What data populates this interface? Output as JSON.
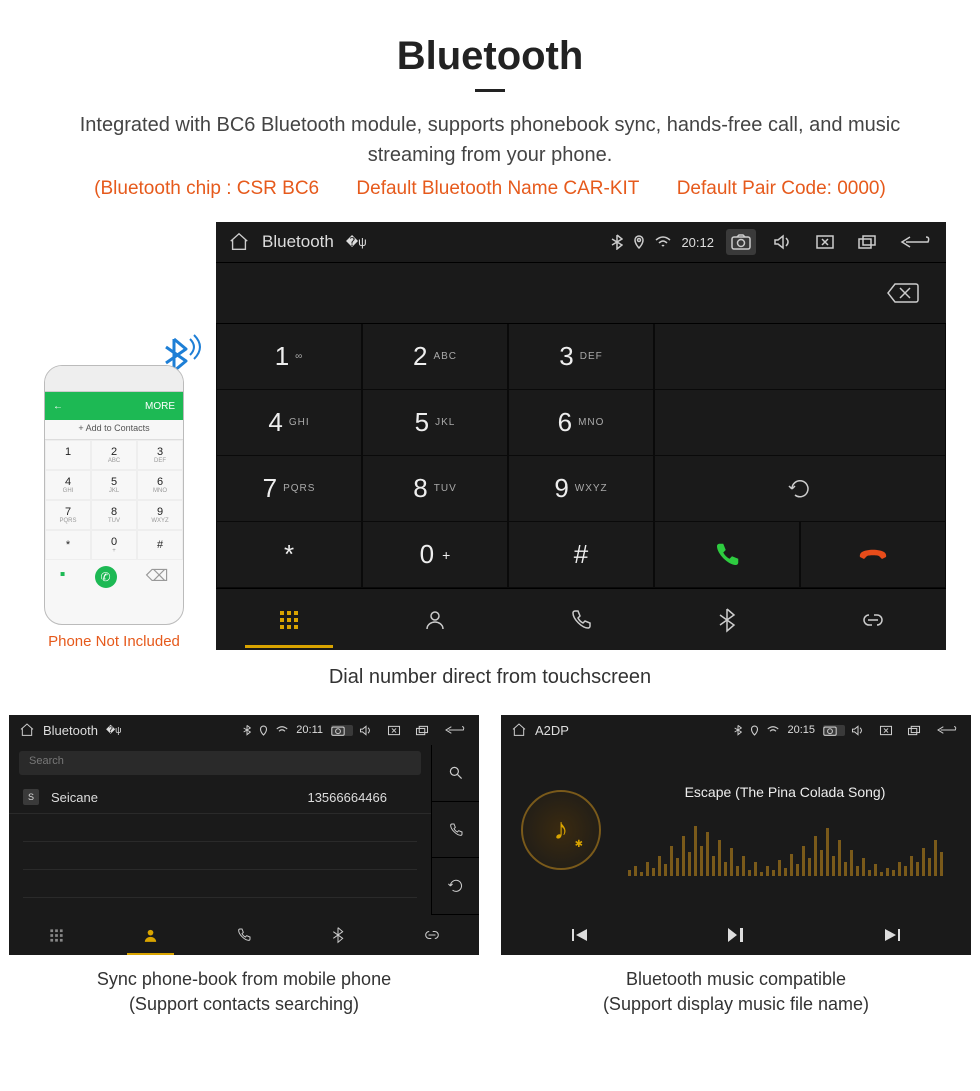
{
  "header": {
    "title": "Bluetooth",
    "subtitle": "Integrated with BC6 Bluetooth module, supports phonebook sync, hands-free call, and music streaming from your phone.",
    "spec_chip": "(Bluetooth chip : CSR BC6",
    "spec_name": "Default Bluetooth Name CAR-KIT",
    "spec_pair": "Default Pair Code: 0000)"
  },
  "phone_mock": {
    "bar_left": "←",
    "bar_right": "MORE",
    "add_label": "+  Add to Contacts",
    "caption": "Phone Not Included"
  },
  "dialer": {
    "status_title": "Bluetooth",
    "time": "20:12",
    "keys": [
      {
        "num": "1",
        "sub": "∞"
      },
      {
        "num": "2",
        "sub": "ABC"
      },
      {
        "num": "3",
        "sub": "DEF"
      },
      {
        "num": "4",
        "sub": "GHI"
      },
      {
        "num": "5",
        "sub": "JKL"
      },
      {
        "num": "6",
        "sub": "MNO"
      },
      {
        "num": "7",
        "sub": "PQRS"
      },
      {
        "num": "8",
        "sub": "TUV"
      },
      {
        "num": "9",
        "sub": "WXYZ"
      },
      {
        "num": "*",
        "sub": ""
      },
      {
        "num": "0",
        "sub": "+"
      },
      {
        "num": "#",
        "sub": ""
      }
    ],
    "caption": "Dial number direct from touchscreen"
  },
  "contacts": {
    "status_title": "Bluetooth",
    "time": "20:11",
    "search_placeholder": "Search",
    "entry_badge": "S",
    "entry_name": "Seicane",
    "entry_number": "13566664466",
    "caption_line1": "Sync phone-book from mobile phone",
    "caption_line2": "(Support contacts searching)"
  },
  "music": {
    "status_title": "A2DP",
    "time": "20:15",
    "track_title": "Escape (The Pina Colada Song)",
    "caption_line1": "Bluetooth music compatible",
    "caption_line2": "(Support display music file name)"
  }
}
